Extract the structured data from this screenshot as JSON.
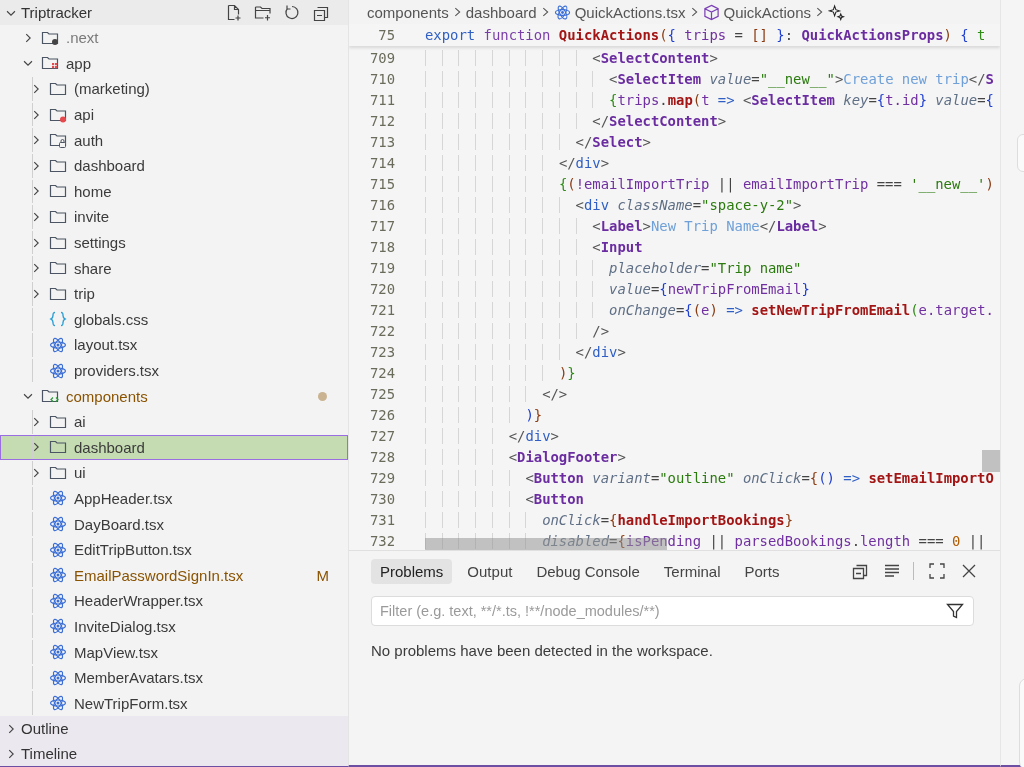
{
  "explorer": {
    "title": "Triptracker",
    "expanded": true,
    "tree": [
      {
        "label": ".next",
        "kind": "folder-next",
        "expanded": false,
        "selected": false,
        "modified": false,
        "dimmed": true
      },
      {
        "label": "app",
        "kind": "folder-app",
        "expanded": true,
        "selected": false,
        "modified": false,
        "dimmed": false,
        "children": [
          {
            "label": "(marketing)",
            "kind": "folder",
            "expanded": false,
            "selected": false,
            "modified": false,
            "dimmed": false
          },
          {
            "label": "api",
            "kind": "folder-api",
            "expanded": false,
            "selected": false,
            "modified": false,
            "dimmed": false
          },
          {
            "label": "auth",
            "kind": "folder-auth",
            "expanded": false,
            "selected": false,
            "modified": false,
            "dimmed": false
          },
          {
            "label": "dashboard",
            "kind": "folder",
            "expanded": false,
            "selected": false,
            "modified": false,
            "dimmed": false
          },
          {
            "label": "home",
            "kind": "folder",
            "expanded": false,
            "selected": false,
            "modified": false,
            "dimmed": false
          },
          {
            "label": "invite",
            "kind": "folder",
            "expanded": false,
            "selected": false,
            "modified": false,
            "dimmed": false
          },
          {
            "label": "settings",
            "kind": "folder",
            "expanded": false,
            "selected": false,
            "modified": false,
            "dimmed": false
          },
          {
            "label": "share",
            "kind": "folder",
            "expanded": false,
            "selected": false,
            "modified": false,
            "dimmed": false
          },
          {
            "label": "trip",
            "kind": "folder",
            "expanded": false,
            "selected": false,
            "modified": false,
            "dimmed": false
          },
          {
            "label": "globals.css",
            "kind": "css-file",
            "selected": false,
            "modified": false,
            "dimmed": false
          },
          {
            "label": "layout.tsx",
            "kind": "react-file",
            "selected": false,
            "modified": false,
            "dimmed": false
          },
          {
            "label": "providers.tsx",
            "kind": "react-file",
            "selected": false,
            "modified": false,
            "dimmed": false
          }
        ]
      },
      {
        "label": "components",
        "kind": "folder-components",
        "expanded": true,
        "selected": false,
        "modified": true,
        "dimmed": false,
        "children": [
          {
            "label": "ai",
            "kind": "folder",
            "expanded": false,
            "selected": false,
            "modified": false,
            "dimmed": false
          },
          {
            "label": "dashboard",
            "kind": "folder",
            "expanded": false,
            "selected": true,
            "modified": false,
            "dimmed": false
          },
          {
            "label": "ui",
            "kind": "folder",
            "expanded": false,
            "selected": false,
            "modified": false,
            "dimmed": false
          },
          {
            "label": "AppHeader.tsx",
            "kind": "react-file",
            "selected": false,
            "modified": false,
            "dimmed": false
          },
          {
            "label": "DayBoard.tsx",
            "kind": "react-file",
            "selected": false,
            "modified": false,
            "dimmed": false
          },
          {
            "label": "EditTripButton.tsx",
            "kind": "react-file",
            "selected": false,
            "modified": false,
            "dimmed": false
          },
          {
            "label": "EmailPasswordSignIn.tsx",
            "kind": "react-file",
            "selected": false,
            "modified": true,
            "dimmed": false,
            "badge": "M"
          },
          {
            "label": "HeaderWrapper.tsx",
            "kind": "react-file",
            "selected": false,
            "modified": false,
            "dimmed": false
          },
          {
            "label": "InviteDialog.tsx",
            "kind": "react-file",
            "selected": false,
            "modified": false,
            "dimmed": false
          },
          {
            "label": "MapView.tsx",
            "kind": "react-file",
            "selected": false,
            "modified": false,
            "dimmed": false
          },
          {
            "label": "MemberAvatars.tsx",
            "kind": "react-file",
            "selected": false,
            "modified": false,
            "dimmed": false
          },
          {
            "label": "NewTripForm.tsx",
            "kind": "react-file",
            "selected": false,
            "modified": false,
            "dimmed": false
          }
        ]
      }
    ]
  },
  "sections": [
    {
      "label": "Outline",
      "expanded": false
    },
    {
      "label": "Timeline",
      "expanded": false
    }
  ],
  "breadcrumb": [
    {
      "label": "components",
      "kind": "folder"
    },
    {
      "label": "dashboard",
      "kind": "folder"
    },
    {
      "label": "QuickActions.tsx",
      "kind": "react-file"
    },
    {
      "label": "QuickActions",
      "kind": "symbol"
    }
  ],
  "editor": {
    "sticky": {
      "number": "75",
      "tokens": [
        {
          "text": "export ",
          "kind": "kw"
        },
        {
          "text": "function ",
          "kind": "kw2"
        },
        {
          "text": "QuickActions",
          "kind": "fn"
        },
        {
          "text": "(",
          "kind": "b3"
        },
        {
          "text": "{",
          "kind": "b1"
        },
        {
          "text": " trips ",
          "kind": "var"
        },
        {
          "text": "= ",
          "kind": "punct"
        },
        {
          "text": "[] ",
          "kind": "b3"
        },
        {
          "text": "}",
          "kind": "b1"
        },
        {
          "text": ": ",
          "kind": "punct"
        },
        {
          "text": "QuickActionsProps",
          "kind": "tag"
        },
        {
          "text": ") ",
          "kind": "b3"
        },
        {
          "text": "{",
          "kind": "b1"
        },
        {
          "text": " t",
          "kind": "b2"
        }
      ]
    },
    "lines": [
      {
        "number": "709",
        "tokens": [
          {
            "text": "                    <",
            "kind": "tagp"
          },
          {
            "text": "SelectContent",
            "kind": "tag"
          },
          {
            "text": ">",
            "kind": "tagp"
          }
        ]
      },
      {
        "number": "710",
        "tokens": [
          {
            "text": "                      <",
            "kind": "tagp"
          },
          {
            "text": "SelectItem ",
            "kind": "tag"
          },
          {
            "text": "value",
            "kind": "attr"
          },
          {
            "text": "=",
            "kind": "punct"
          },
          {
            "text": "\"__new__\"",
            "kind": "str"
          },
          {
            "text": ">",
            "kind": "tagp"
          },
          {
            "text": "Create new trip",
            "kind": "jsx"
          },
          {
            "text": "</",
            "kind": "tagp"
          },
          {
            "text": "S",
            "kind": "tag"
          }
        ]
      },
      {
        "number": "711",
        "tokens": [
          {
            "text": "                      {",
            "kind": "b2"
          },
          {
            "text": "trips",
            "kind": "var"
          },
          {
            "text": ".",
            "kind": "punct"
          },
          {
            "text": "map",
            "kind": "fn"
          },
          {
            "text": "(",
            "kind": "b3"
          },
          {
            "text": "t ",
            "kind": "var"
          },
          {
            "text": "=>",
            "kind": "kw"
          },
          {
            "text": " <",
            "kind": "tagp"
          },
          {
            "text": "SelectItem ",
            "kind": "tag"
          },
          {
            "text": "key",
            "kind": "attr"
          },
          {
            "text": "=",
            "kind": "punct"
          },
          {
            "text": "{",
            "kind": "b1"
          },
          {
            "text": "t.id",
            "kind": "var"
          },
          {
            "text": "} ",
            "kind": "b1"
          },
          {
            "text": "value",
            "kind": "attr"
          },
          {
            "text": "=",
            "kind": "punct"
          },
          {
            "text": "{",
            "kind": "b1"
          }
        ]
      },
      {
        "number": "712",
        "tokens": [
          {
            "text": "                    </",
            "kind": "tagp"
          },
          {
            "text": "SelectContent",
            "kind": "tag"
          },
          {
            "text": ">",
            "kind": "tagp"
          }
        ]
      },
      {
        "number": "713",
        "tokens": [
          {
            "text": "                  </",
            "kind": "tagp"
          },
          {
            "text": "Select",
            "kind": "tag"
          },
          {
            "text": ">",
            "kind": "tagp"
          }
        ]
      },
      {
        "number": "714",
        "tokens": [
          {
            "text": "                </",
            "kind": "tagp"
          },
          {
            "text": "div",
            "kind": "html"
          },
          {
            "text": ">",
            "kind": "tagp"
          }
        ]
      },
      {
        "number": "715",
        "tokens": [
          {
            "text": "                {",
            "kind": "b2"
          },
          {
            "text": "(",
            "kind": "b3"
          },
          {
            "text": "!emailImportTrip",
            "kind": "var"
          },
          {
            "text": " || ",
            "kind": "punct"
          },
          {
            "text": "emailImportTrip",
            "kind": "var"
          },
          {
            "text": " === ",
            "kind": "punct"
          },
          {
            "text": "'__new__'",
            "kind": "str"
          },
          {
            "text": ")",
            "kind": "b3"
          }
        ]
      },
      {
        "number": "716",
        "tokens": [
          {
            "text": "                  <",
            "kind": "tagp"
          },
          {
            "text": "div ",
            "kind": "html"
          },
          {
            "text": "className",
            "kind": "attr"
          },
          {
            "text": "=",
            "kind": "punct"
          },
          {
            "text": "\"space-y-2\"",
            "kind": "str"
          },
          {
            "text": ">",
            "kind": "tagp"
          }
        ]
      },
      {
        "number": "717",
        "tokens": [
          {
            "text": "                    <",
            "kind": "tagp"
          },
          {
            "text": "Label",
            "kind": "tag"
          },
          {
            "text": ">",
            "kind": "tagp"
          },
          {
            "text": "New Trip Name",
            "kind": "jsx"
          },
          {
            "text": "</",
            "kind": "tagp"
          },
          {
            "text": "Label",
            "kind": "tag"
          },
          {
            "text": ">",
            "kind": "tagp"
          }
        ]
      },
      {
        "number": "718",
        "tokens": [
          {
            "text": "                    <",
            "kind": "tagp"
          },
          {
            "text": "Input",
            "kind": "tag"
          }
        ]
      },
      {
        "number": "719",
        "tokens": [
          {
            "text": "                      placeholder",
            "kind": "attr"
          },
          {
            "text": "=",
            "kind": "punct"
          },
          {
            "text": "\"Trip name\"",
            "kind": "str"
          }
        ]
      },
      {
        "number": "720",
        "tokens": [
          {
            "text": "                      value",
            "kind": "attr"
          },
          {
            "text": "=",
            "kind": "punct"
          },
          {
            "text": "{",
            "kind": "b1"
          },
          {
            "text": "newTripFromEmail",
            "kind": "var"
          },
          {
            "text": "}",
            "kind": "b1"
          }
        ]
      },
      {
        "number": "721",
        "tokens": [
          {
            "text": "                      onChange",
            "kind": "attr"
          },
          {
            "text": "=",
            "kind": "punct"
          },
          {
            "text": "{",
            "kind": "b1"
          },
          {
            "text": "(",
            "kind": "b3"
          },
          {
            "text": "e",
            "kind": "var"
          },
          {
            "text": ")",
            "kind": "b3"
          },
          {
            "text": " => ",
            "kind": "kw"
          },
          {
            "text": "setNewTripFromEmail",
            "kind": "fn"
          },
          {
            "text": "(",
            "kind": "b2"
          },
          {
            "text": "e.target.",
            "kind": "var"
          }
        ]
      },
      {
        "number": "722",
        "tokens": [
          {
            "text": "                    />",
            "kind": "tagp"
          }
        ]
      },
      {
        "number": "723",
        "tokens": [
          {
            "text": "                  </",
            "kind": "tagp"
          },
          {
            "text": "div",
            "kind": "html"
          },
          {
            "text": ">",
            "kind": "tagp"
          }
        ]
      },
      {
        "number": "724",
        "tokens": [
          {
            "text": "                )",
            "kind": "b3"
          },
          {
            "text": "}",
            "kind": "b2"
          }
        ]
      },
      {
        "number": "725",
        "tokens": [
          {
            "text": "              </>",
            "kind": "tagp"
          }
        ]
      },
      {
        "number": "726",
        "tokens": [
          {
            "text": "            )",
            "kind": "b1"
          },
          {
            "text": "}",
            "kind": "b3"
          }
        ]
      },
      {
        "number": "727",
        "tokens": [
          {
            "text": "          </",
            "kind": "tagp"
          },
          {
            "text": "div",
            "kind": "html"
          },
          {
            "text": ">",
            "kind": "tagp"
          }
        ]
      },
      {
        "number": "728",
        "tokens": [
          {
            "text": "          <",
            "kind": "tagp"
          },
          {
            "text": "DialogFooter",
            "kind": "tag"
          },
          {
            "text": ">",
            "kind": "tagp"
          }
        ]
      },
      {
        "number": "729",
        "tokens": [
          {
            "text": "            <",
            "kind": "tagp"
          },
          {
            "text": "Button ",
            "kind": "tag"
          },
          {
            "text": "variant",
            "kind": "attr"
          },
          {
            "text": "=",
            "kind": "punct"
          },
          {
            "text": "\"outline\" ",
            "kind": "str"
          },
          {
            "text": "onClick",
            "kind": "attr"
          },
          {
            "text": "=",
            "kind": "punct"
          },
          {
            "text": "{",
            "kind": "b3"
          },
          {
            "text": "()",
            "kind": "b1"
          },
          {
            "text": " => ",
            "kind": "kw"
          },
          {
            "text": "setEmailImportO",
            "kind": "fn"
          }
        ]
      },
      {
        "number": "730",
        "tokens": [
          {
            "text": "            <",
            "kind": "tagp"
          },
          {
            "text": "Button",
            "kind": "tag"
          }
        ]
      },
      {
        "number": "731",
        "tokens": [
          {
            "text": "              onClick",
            "kind": "attr"
          },
          {
            "text": "=",
            "kind": "punct"
          },
          {
            "text": "{",
            "kind": "b3"
          },
          {
            "text": "handleImportBookings",
            "kind": "fn"
          },
          {
            "text": "}",
            "kind": "b3"
          }
        ]
      },
      {
        "number": "732",
        "tokens": [
          {
            "text": "              disabled",
            "kind": "attr"
          },
          {
            "text": "=",
            "kind": "punct"
          },
          {
            "text": "{",
            "kind": "b3"
          },
          {
            "text": "isPending",
            "kind": "var"
          },
          {
            "text": " || ",
            "kind": "punct"
          },
          {
            "text": "parsedBookings",
            "kind": "var"
          },
          {
            "text": ".",
            "kind": "punct"
          },
          {
            "text": "length",
            "kind": "var"
          },
          {
            "text": " === ",
            "kind": "punct"
          },
          {
            "text": "0",
            "kind": "num"
          },
          {
            "text": " ||",
            "kind": "punct"
          }
        ]
      }
    ]
  },
  "panel": {
    "tabs": [
      {
        "label": "Problems",
        "selected": true
      },
      {
        "label": "Output",
        "selected": false
      },
      {
        "label": "Debug Console",
        "selected": false
      },
      {
        "label": "Terminal",
        "selected": false
      },
      {
        "label": "Ports",
        "selected": false
      }
    ],
    "filter": {
      "placeholder": "Filter (e.g. text, **/*.ts, !**/node_modules/**)"
    },
    "message": "No problems have been detected in the workspace."
  }
}
